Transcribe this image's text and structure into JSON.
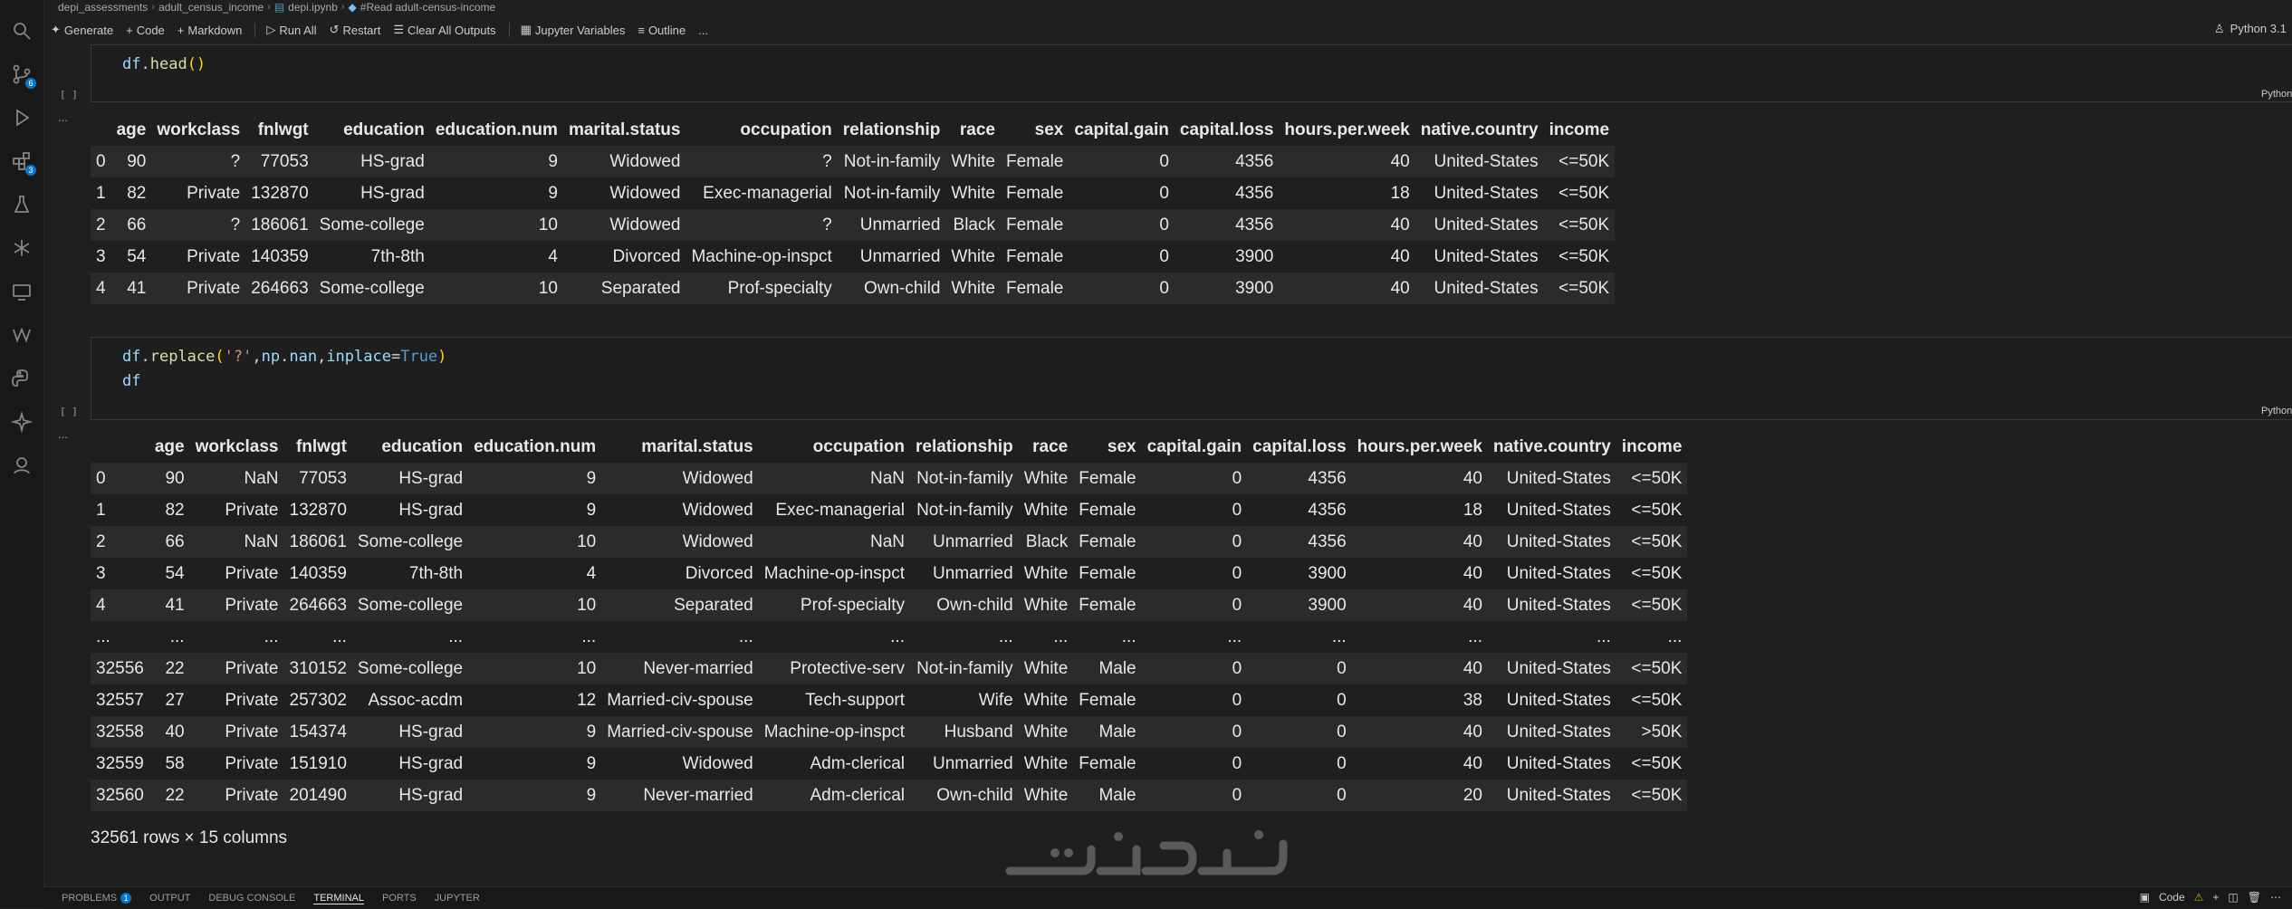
{
  "breadcrumb": [
    "depi_assessments",
    "adult_census_income",
    "depi.ipynb",
    "#Read adult-census-income"
  ],
  "toolbar": {
    "generate": "Generate",
    "code": "Code",
    "markdown": "Markdown",
    "run_all": "Run All",
    "restart": "Restart",
    "clear_outputs": "Clear All Outputs",
    "variables": "Jupyter Variables",
    "outline": "Outline",
    "more": "...",
    "kernel": "Python 3.1"
  },
  "activity_badges": {
    "scm": "6",
    "extensions": "3"
  },
  "cells": [
    {
      "code_lines": [
        "df.head()"
      ],
      "exec_label": "[ ]",
      "lang": "Python",
      "output_dots": "...",
      "table": {
        "columns": [
          "",
          "age",
          "workclass",
          "fnlwgt",
          "education",
          "education.num",
          "marital.status",
          "occupation",
          "relationship",
          "race",
          "sex",
          "capital.gain",
          "capital.loss",
          "hours.per.week",
          "native.country",
          "income"
        ],
        "rows": [
          [
            "0",
            "90",
            "?",
            "77053",
            "HS-grad",
            "9",
            "Widowed",
            "?",
            "Not-in-family",
            "White",
            "Female",
            "0",
            "4356",
            "40",
            "United-States",
            "<=50K"
          ],
          [
            "1",
            "82",
            "Private",
            "132870",
            "HS-grad",
            "9",
            "Widowed",
            "Exec-managerial",
            "Not-in-family",
            "White",
            "Female",
            "0",
            "4356",
            "18",
            "United-States",
            "<=50K"
          ],
          [
            "2",
            "66",
            "?",
            "186061",
            "Some-college",
            "10",
            "Widowed",
            "?",
            "Unmarried",
            "Black",
            "Female",
            "0",
            "4356",
            "40",
            "United-States",
            "<=50K"
          ],
          [
            "3",
            "54",
            "Private",
            "140359",
            "7th-8th",
            "4",
            "Divorced",
            "Machine-op-inspct",
            "Unmarried",
            "White",
            "Female",
            "0",
            "3900",
            "40",
            "United-States",
            "<=50K"
          ],
          [
            "4",
            "41",
            "Private",
            "264663",
            "Some-college",
            "10",
            "Separated",
            "Prof-specialty",
            "Own-child",
            "White",
            "Female",
            "0",
            "3900",
            "40",
            "United-States",
            "<=50K"
          ]
        ]
      }
    },
    {
      "code_lines": [
        "df.replace('?',np.nan,inplace=True)",
        "df"
      ],
      "exec_label": "[ ]",
      "lang": "Python",
      "output_dots": "...",
      "table": {
        "columns": [
          "",
          "age",
          "workclass",
          "fnlwgt",
          "education",
          "education.num",
          "marital.status",
          "occupation",
          "relationship",
          "race",
          "sex",
          "capital.gain",
          "capital.loss",
          "hours.per.week",
          "native.country",
          "income"
        ],
        "rows": [
          [
            "0",
            "90",
            "NaN",
            "77053",
            "HS-grad",
            "9",
            "Widowed",
            "NaN",
            "Not-in-family",
            "White",
            "Female",
            "0",
            "4356",
            "40",
            "United-States",
            "<=50K"
          ],
          [
            "1",
            "82",
            "Private",
            "132870",
            "HS-grad",
            "9",
            "Widowed",
            "Exec-managerial",
            "Not-in-family",
            "White",
            "Female",
            "0",
            "4356",
            "18",
            "United-States",
            "<=50K"
          ],
          [
            "2",
            "66",
            "NaN",
            "186061",
            "Some-college",
            "10",
            "Widowed",
            "NaN",
            "Unmarried",
            "Black",
            "Female",
            "0",
            "4356",
            "40",
            "United-States",
            "<=50K"
          ],
          [
            "3",
            "54",
            "Private",
            "140359",
            "7th-8th",
            "4",
            "Divorced",
            "Machine-op-inspct",
            "Unmarried",
            "White",
            "Female",
            "0",
            "3900",
            "40",
            "United-States",
            "<=50K"
          ],
          [
            "4",
            "41",
            "Private",
            "264663",
            "Some-college",
            "10",
            "Separated",
            "Prof-specialty",
            "Own-child",
            "White",
            "Female",
            "0",
            "3900",
            "40",
            "United-States",
            "<=50K"
          ],
          [
            "...",
            "...",
            "...",
            "...",
            "...",
            "...",
            "...",
            "...",
            "...",
            "...",
            "...",
            "...",
            "...",
            "...",
            "...",
            "..."
          ],
          [
            "32556",
            "22",
            "Private",
            "310152",
            "Some-college",
            "10",
            "Never-married",
            "Protective-serv",
            "Not-in-family",
            "White",
            "Male",
            "0",
            "0",
            "40",
            "United-States",
            "<=50K"
          ],
          [
            "32557",
            "27",
            "Private",
            "257302",
            "Assoc-acdm",
            "12",
            "Married-civ-spouse",
            "Tech-support",
            "Wife",
            "White",
            "Female",
            "0",
            "0",
            "38",
            "United-States",
            "<=50K"
          ],
          [
            "32558",
            "40",
            "Private",
            "154374",
            "HS-grad",
            "9",
            "Married-civ-spouse",
            "Machine-op-inspct",
            "Husband",
            "White",
            "Male",
            "0",
            "0",
            "40",
            "United-States",
            ">50K"
          ],
          [
            "32559",
            "58",
            "Private",
            "151910",
            "HS-grad",
            "9",
            "Widowed",
            "Adm-clerical",
            "Unmarried",
            "White",
            "Female",
            "0",
            "0",
            "40",
            "United-States",
            "<=50K"
          ],
          [
            "32560",
            "22",
            "Private",
            "201490",
            "HS-grad",
            "9",
            "Never-married",
            "Adm-clerical",
            "Own-child",
            "White",
            "Male",
            "0",
            "0",
            "20",
            "United-States",
            "<=50K"
          ]
        ]
      },
      "shape_text": "32561 rows × 15 columns"
    }
  ],
  "panel": {
    "tabs": [
      "PROBLEMS",
      "OUTPUT",
      "DEBUG CONSOLE",
      "TERMINAL",
      "PORTS",
      "JUPYTER"
    ],
    "problems_badge": "1",
    "active_tab": "TERMINAL",
    "right_label": "Code"
  },
  "colors": {
    "background": "#1f1f1f",
    "accent": "#0078d4",
    "string": "#ce9178",
    "function": "#dcdcaa",
    "keyword": "#569cd6"
  }
}
